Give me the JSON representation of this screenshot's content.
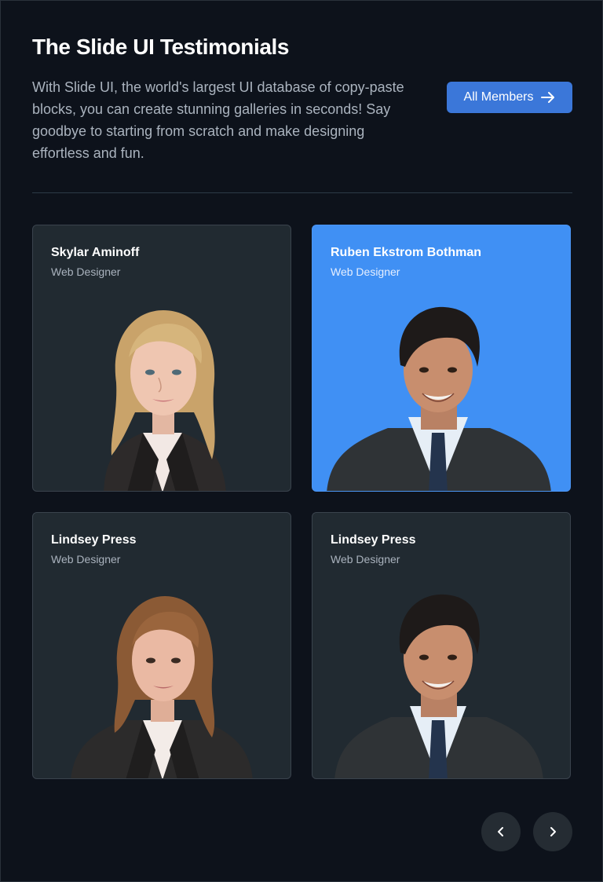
{
  "header": {
    "title": "The Slide UI Testimonials",
    "description": "With Slide UI, the world's largest UI database of copy-paste blocks, you can create stunning galleries in seconds! Say goodbye to starting from scratch and make designing effortless and fun.",
    "all_members_label": "All Members"
  },
  "cards": [
    {
      "name": "Skylar Aminoff",
      "role": "Web Designer"
    },
    {
      "name": "Ruben Ekstrom Bothman",
      "role": "Web Designer"
    },
    {
      "name": "Lindsey Press",
      "role": "Web Designer"
    },
    {
      "name": "Lindsey Press",
      "role": "Web Designer"
    }
  ],
  "colors": {
    "background": "#0d121b",
    "card": "#212a31",
    "card_active": "#4090f4",
    "accent_button": "#3b77d9"
  },
  "icons": {
    "all_members": "arrow-right-icon",
    "prev": "chevron-left-icon",
    "next": "chevron-right-icon"
  }
}
